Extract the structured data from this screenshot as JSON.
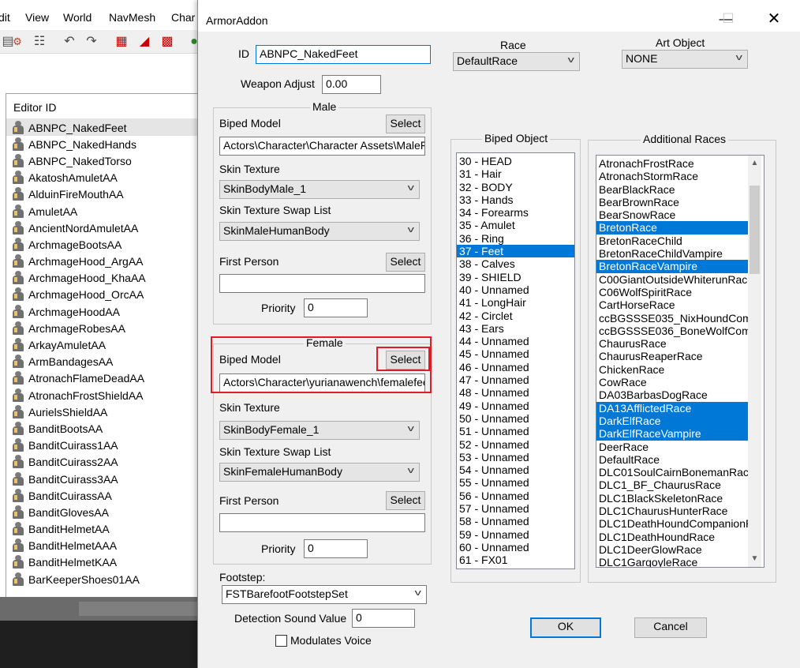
{
  "background_window": {
    "menu": [
      "dit",
      "View",
      "World",
      "NavMesh",
      "Char"
    ],
    "list_header": "Editor ID",
    "items": [
      "ABNPC_NakedFeet",
      "ABNPC_NakedHands",
      "ABNPC_NakedTorso",
      "AkatoshAmuletAA",
      "AlduinFireMouthAA",
      "AmuletAA",
      "AncientNordAmuletAA",
      "ArchmageBootsAA",
      "ArchmageHood_ArgAA",
      "ArchmageHood_KhaAA",
      "ArchmageHood_OrcAA",
      "ArchmageHoodAA",
      "ArchmageRobesAA",
      "ArkayAmuletAA",
      "ArmBandagesAA",
      "AtronachFlameDeadAA",
      "AtronachFrostShieldAA",
      "AurielsShieldAA",
      "BanditBootsAA",
      "BanditCuirass1AA",
      "BanditCuirass2AA",
      "BanditCuirass3AA",
      "BanditCuirassAA",
      "BanditGlovesAA",
      "BanditHelmetAA",
      "BanditHelmetAAA",
      "BanditHelmetKAA",
      "BarKeeperShoes01AA"
    ]
  },
  "dialog": {
    "title": "ArmorAddon",
    "id_label": "ID",
    "id_value": "ABNPC_NakedFeet",
    "weapon_adjust_label": "Weapon Adjust",
    "weapon_adjust_value": "0.00",
    "race_label": "Race",
    "race_value": "DefaultRace",
    "art_object_label": "Art Object",
    "art_object_value": "NONE",
    "select_label": "Select",
    "male": {
      "legend": "Male",
      "biped_model_label": "Biped Model",
      "biped_model_value": "Actors\\Character\\Character Assets\\MaleFe",
      "skin_texture_label": "Skin Texture",
      "skin_texture_value": "SkinBodyMale_1",
      "swap_list_label": "Skin Texture Swap List",
      "swap_list_value": "SkinMaleHumanBody",
      "first_person_label": "First Person",
      "first_person_value": "",
      "priority_label": "Priority",
      "priority_value": "0"
    },
    "female": {
      "legend": "Female",
      "biped_model_label": "Biped Model",
      "biped_model_value": "Actors\\Character\\yurianawench\\femalefee",
      "skin_texture_label": "Skin Texture",
      "skin_texture_value": "SkinBodyFemale_1",
      "swap_list_label": "Skin Texture Swap List",
      "swap_list_value": "SkinFemaleHumanBody",
      "first_person_label": "First Person",
      "first_person_value": "",
      "priority_label": "Priority",
      "priority_value": "0"
    },
    "footstep_label": "Footstep:",
    "footstep_value": "FSTBarefootFootstepSet",
    "detection_sound_label": "Detection Sound Value",
    "detection_sound_value": "0",
    "modulates_voice_label": "Modulates Voice",
    "modulates_voice_checked": false,
    "biped_object_legend": "Biped Object",
    "biped_objects": [
      {
        "label": "30 - HEAD",
        "selected": false
      },
      {
        "label": "31 - Hair",
        "selected": false
      },
      {
        "label": "32 - BODY",
        "selected": false
      },
      {
        "label": "33 - Hands",
        "selected": false
      },
      {
        "label": "34 - Forearms",
        "selected": false
      },
      {
        "label": "35 - Amulet",
        "selected": false
      },
      {
        "label": "36 - Ring",
        "selected": false
      },
      {
        "label": "37 - Feet",
        "selected": true
      },
      {
        "label": "38 - Calves",
        "selected": false
      },
      {
        "label": "39 - SHIELD",
        "selected": false
      },
      {
        "label": "40 - Unnamed",
        "selected": false
      },
      {
        "label": "41 - LongHair",
        "selected": false
      },
      {
        "label": "42 - Circlet",
        "selected": false
      },
      {
        "label": "43 - Ears",
        "selected": false
      },
      {
        "label": "44 - Unnamed",
        "selected": false
      },
      {
        "label": "45 - Unnamed",
        "selected": false
      },
      {
        "label": "46 - Unnamed",
        "selected": false
      },
      {
        "label": "47 - Unnamed",
        "selected": false
      },
      {
        "label": "48 - Unnamed",
        "selected": false
      },
      {
        "label": "49 - Unnamed",
        "selected": false
      },
      {
        "label": "50 - Unnamed",
        "selected": false
      },
      {
        "label": "51 - Unnamed",
        "selected": false
      },
      {
        "label": "52 - Unnamed",
        "selected": false
      },
      {
        "label": "53 - Unnamed",
        "selected": false
      },
      {
        "label": "54 - Unnamed",
        "selected": false
      },
      {
        "label": "55 - Unnamed",
        "selected": false
      },
      {
        "label": "56 - Unnamed",
        "selected": false
      },
      {
        "label": "57 - Unnamed",
        "selected": false
      },
      {
        "label": "58 - Unnamed",
        "selected": false
      },
      {
        "label": "59 - Unnamed",
        "selected": false
      },
      {
        "label": "60 - Unnamed",
        "selected": false
      },
      {
        "label": "61 - FX01",
        "selected": false
      }
    ],
    "additional_races_legend": "Additional Races",
    "additional_races": [
      {
        "label": "AtronachFrostRace",
        "selected": false
      },
      {
        "label": "AtronachStormRace",
        "selected": false
      },
      {
        "label": "BearBlackRace",
        "selected": false
      },
      {
        "label": "BearBrownRace",
        "selected": false
      },
      {
        "label": "BearSnowRace",
        "selected": false
      },
      {
        "label": "BretonRace",
        "selected": true
      },
      {
        "label": "BretonRaceChild",
        "selected": false
      },
      {
        "label": "BretonRaceChildVampire",
        "selected": false
      },
      {
        "label": "BretonRaceVampire",
        "selected": true
      },
      {
        "label": "C00GiantOutsideWhiterunRace",
        "selected": false
      },
      {
        "label": "C06WolfSpiritRace",
        "selected": false
      },
      {
        "label": "CartHorseRace",
        "selected": false
      },
      {
        "label": "ccBGSSSE035_NixHoundCom",
        "selected": false
      },
      {
        "label": "ccBGSSSE036_BoneWolfCom",
        "selected": false
      },
      {
        "label": "ChaurusRace",
        "selected": false
      },
      {
        "label": "ChaurusReaperRace",
        "selected": false
      },
      {
        "label": "ChickenRace",
        "selected": false
      },
      {
        "label": "CowRace",
        "selected": false
      },
      {
        "label": "DA03BarbasDogRace",
        "selected": false
      },
      {
        "label": "DA13AfflictedRace",
        "selected": true
      },
      {
        "label": "DarkElfRace",
        "selected": true
      },
      {
        "label": "DarkElfRaceVampire",
        "selected": true
      },
      {
        "label": "DeerRace",
        "selected": false
      },
      {
        "label": "DefaultRace",
        "selected": false
      },
      {
        "label": "DLC01SoulCairnBonemanRace",
        "selected": false
      },
      {
        "label": "DLC1_BF_ChaurusRace",
        "selected": false
      },
      {
        "label": "DLC1BlackSkeletonRace",
        "selected": false
      },
      {
        "label": "DLC1ChaurusHunterRace",
        "selected": false
      },
      {
        "label": "DLC1DeathHoundCompanionR",
        "selected": false
      },
      {
        "label": "DLC1DeathHoundRace",
        "selected": false
      },
      {
        "label": "DLC1DeerGlowRace",
        "selected": false
      },
      {
        "label": "DLC1GargoyleRace",
        "selected": false
      }
    ],
    "ok_label": "OK",
    "cancel_label": "Cancel"
  },
  "colors": {
    "selection": "#0078d7",
    "highlight_annotation": "#e01b24",
    "dialog_bg": "#f0f0f0"
  }
}
